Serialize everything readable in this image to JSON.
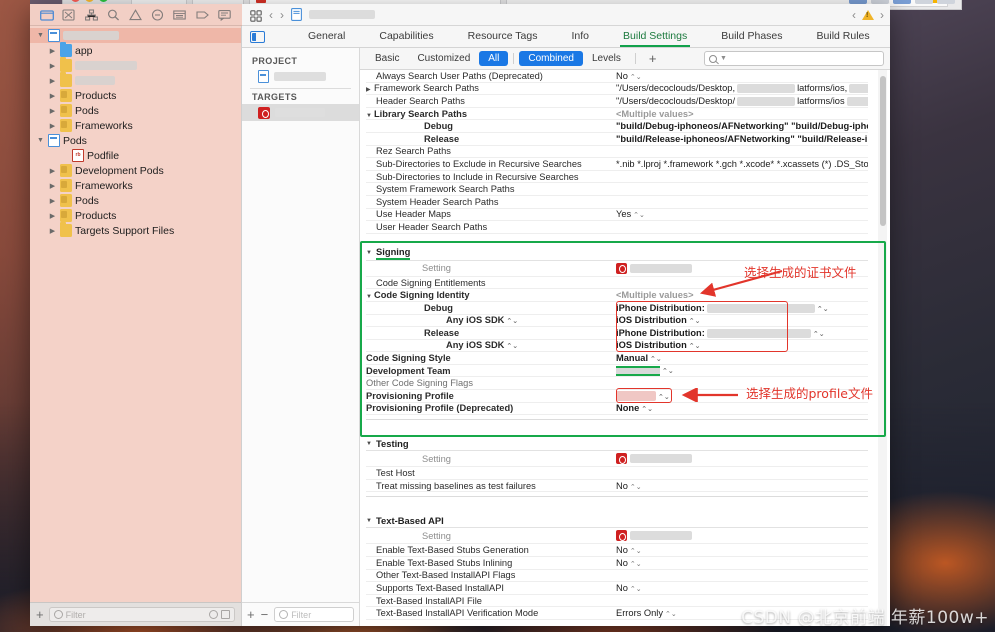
{
  "window": {
    "app": "Xcode",
    "jump_bar": {
      "doc_redacted": true
    }
  },
  "navigator_toolbar": {
    "icons": [
      "folder-icon",
      "issue-icon",
      "hierarchy-icon",
      "search-icon",
      "warning-icon",
      "breakpoint-icon",
      "report-icon",
      "tag-icon",
      "comment-icon"
    ]
  },
  "navigator": {
    "tree": [
      {
        "label": "",
        "redacted": true,
        "redact_w": 56,
        "depth": 0,
        "twisty": "down",
        "icon": "blue-doc",
        "selected": true
      },
      {
        "label": "app",
        "depth": 1,
        "twisty": "right",
        "icon": "folder-blue"
      },
      {
        "label": "",
        "redacted": true,
        "redact_w": 62,
        "depth": 1,
        "twisty": "right",
        "icon": "folder-y"
      },
      {
        "label": "",
        "redacted": true,
        "redact_w": 40,
        "depth": 1,
        "twisty": "right",
        "icon": "folder-y"
      },
      {
        "label": "Products",
        "depth": 1,
        "twisty": "right",
        "icon": "folder-g"
      },
      {
        "label": "Pods",
        "depth": 1,
        "twisty": "right",
        "icon": "folder-g"
      },
      {
        "label": "Frameworks",
        "depth": 1,
        "twisty": "right",
        "icon": "folder-g"
      },
      {
        "label": "Pods",
        "depth": 0,
        "twisty": "down",
        "icon": "blue-doc"
      },
      {
        "label": "Podfile",
        "depth": 2,
        "twisty": "none",
        "icon": "rb"
      },
      {
        "label": "Development Pods",
        "depth": 1,
        "twisty": "right",
        "icon": "folder-g"
      },
      {
        "label": "Frameworks",
        "depth": 1,
        "twisty": "right",
        "icon": "folder-g"
      },
      {
        "label": "Pods",
        "depth": 1,
        "twisty": "right",
        "icon": "folder-g"
      },
      {
        "label": "Products",
        "depth": 1,
        "twisty": "right",
        "icon": "folder-g"
      },
      {
        "label": "Targets Support Files",
        "depth": 1,
        "twisty": "right",
        "icon": "folder-y"
      }
    ],
    "filter_placeholder": "Filter",
    "add_label": "+"
  },
  "editor": {
    "tabs": [
      {
        "label": "General",
        "active": false
      },
      {
        "label": "Capabilities",
        "active": false
      },
      {
        "label": "Resource Tags",
        "active": false
      },
      {
        "label": "Info",
        "active": false
      },
      {
        "label": "Build Settings",
        "active": true
      },
      {
        "label": "Build Phases",
        "active": false
      },
      {
        "label": "Build Rules",
        "active": false
      }
    ]
  },
  "project_targets": {
    "project_header": "PROJECT",
    "project_item": {
      "label": "",
      "redacted": true,
      "redact_w": 58
    },
    "targets_header": "TARGETS",
    "target_item": {
      "label": "",
      "redacted": true,
      "redact_w": 56,
      "selected": true
    },
    "add_label": "+",
    "remove_label": "−",
    "filter_placeholder": "Filter"
  },
  "segmented": {
    "items": [
      {
        "label": "Basic",
        "on": false
      },
      {
        "label": "Customized",
        "on": false
      },
      {
        "label": "All",
        "on": true
      },
      {
        "label": "Combined",
        "on": true
      },
      {
        "label": "Levels",
        "on": false
      }
    ],
    "add_label": "+",
    "search_placeholder": ""
  },
  "settings": {
    "search_paths_rows": [
      {
        "name": "Always Search User Paths (Deprecated)",
        "value": "No",
        "stepper": true,
        "twisty": "none",
        "indent": 1
      },
      {
        "name": "Framework Search Paths",
        "value": "\"/Users/decoclouds/Desktop,",
        "value2": "latforms/ios,",
        "twisty": "right",
        "indent": 0,
        "redactsplit": true
      },
      {
        "name": "Header Search Paths",
        "value": "\"/Users/decoclouds/Desktop/",
        "value2": "latforms/ios",
        "twisty": "none",
        "indent": 1,
        "redactsplit": true
      },
      {
        "name": "Library Search Paths",
        "value": "<Multiple values>",
        "multi": true,
        "twisty": "down",
        "indent": 0,
        "bold": true
      },
      {
        "name": "Debug",
        "value": "\"build/Debug-iphoneos/AFNetworking\" \"build/Debug-iphoneos/…",
        "indent": 2,
        "bold": true
      },
      {
        "name": "Release",
        "value": "\"build/Release-iphoneos/AFNetworking\" \"build/Release-iphone…",
        "indent": 2,
        "bold": true
      },
      {
        "name": "Rez Search Paths",
        "value": "",
        "twisty": "none",
        "indent": 1
      },
      {
        "name": "Sub-Directories to Exclude in Recursive Searches",
        "value": "*.nib *.lproj *.framework *.gch *.xcode* *.xcassets (*) .DS_Store CVS…",
        "twisty": "none",
        "indent": 1
      },
      {
        "name": "Sub-Directories to Include in Recursive Searches",
        "value": "",
        "twisty": "none",
        "indent": 1
      },
      {
        "name": "System Framework Search Paths",
        "value": "",
        "twisty": "none",
        "indent": 1
      },
      {
        "name": "System Header Search Paths",
        "value": "",
        "twisty": "none",
        "indent": 1
      },
      {
        "name": "Use Header Maps",
        "value": "Yes",
        "stepper": true,
        "twisty": "none",
        "indent": 1
      },
      {
        "name": "User Header Search Paths",
        "value": "",
        "twisty": "none",
        "indent": 1
      }
    ],
    "signing": {
      "group_title": "Signing",
      "setting_label": "Setting",
      "rows": [
        {
          "name": "Code Signing Entitlements",
          "value": "",
          "twisty": "none",
          "indent": 1
        },
        {
          "name": "Code Signing Identity",
          "value": "<Multiple values>",
          "multi": true,
          "twisty": "down",
          "indent": 0,
          "bold": true
        },
        {
          "name": "Debug",
          "value": "iPhone Distribution:",
          "redact_after": 108,
          "indent": 2,
          "bold": true,
          "stepper": true
        },
        {
          "name": "Any iOS SDK",
          "value": "iOS Distribution",
          "indent": 3,
          "bold": true,
          "stepper": true,
          "name_stepper": true
        },
        {
          "name": "Release",
          "value": "iPhone Distribution:",
          "redact_after": 104,
          "indent": 2,
          "bold": true,
          "stepper": true
        },
        {
          "name": "Any iOS SDK",
          "value": "iOS Distribution",
          "indent": 3,
          "bold": true,
          "stepper": true,
          "name_stepper": true
        },
        {
          "name": "Code Signing Style",
          "value": "Manual",
          "stepper": true,
          "twisty": "none",
          "indent": 0,
          "bold": true
        },
        {
          "name": "Development Team",
          "value": "",
          "redact_green": true,
          "stepper": true,
          "twisty": "none",
          "indent": 0,
          "bold": true
        },
        {
          "name": "Other Code Signing Flags",
          "value": "",
          "twisty": "none",
          "indent": 0,
          "dim": true
        },
        {
          "name": "Provisioning Profile",
          "value": "",
          "redact_pink": true,
          "stepper": true,
          "twisty": "none",
          "indent": 0,
          "bold": true
        },
        {
          "name": "Provisioning Profile (Deprecated)",
          "value": "None",
          "stepper": true,
          "twisty": "none",
          "indent": 0,
          "bold": true
        }
      ]
    },
    "testing": {
      "group_title": "Testing",
      "setting_label": "Setting",
      "rows": [
        {
          "name": "Test Host",
          "value": "",
          "twisty": "none",
          "indent": 1
        },
        {
          "name": "Treat missing baselines as test failures",
          "value": "No",
          "stepper": true,
          "twisty": "none",
          "indent": 1
        }
      ]
    },
    "text_based_api": {
      "group_title": "Text-Based API",
      "setting_label": "Setting",
      "rows": [
        {
          "name": "Enable Text-Based Stubs Generation",
          "value": "No",
          "stepper": true,
          "twisty": "none",
          "indent": 1
        },
        {
          "name": "Enable Text-Based Stubs Inlining",
          "value": "No",
          "stepper": true,
          "twisty": "none",
          "indent": 1
        },
        {
          "name": "Other Text-Based InstallAPI Flags",
          "value": "",
          "twisty": "none",
          "indent": 1
        },
        {
          "name": "Supports Text-Based InstallAPI",
          "value": "No",
          "stepper": true,
          "twisty": "none",
          "indent": 1
        },
        {
          "name": "Text-Based InstallAPI File",
          "value": "",
          "twisty": "none",
          "indent": 1
        },
        {
          "name": "Text-Based InstallAPI Verification Mode",
          "value": "Errors Only",
          "stepper": true,
          "twisty": "none",
          "indent": 1
        }
      ]
    }
  },
  "annotations": [
    {
      "text": "选择生成的证书文件",
      "color": "#e2352b"
    },
    {
      "text": "选择生成的profile文件",
      "color": "#e2352b"
    }
  ],
  "watermark": {
    "text": "CSDN @北京前端 年薪100w+"
  },
  "colors": {
    "accent_blue": "#1a78e5",
    "annotation_red": "#e2352b",
    "highlight_green": "#17a94a",
    "navigator_bg": "#f4d2c8"
  }
}
